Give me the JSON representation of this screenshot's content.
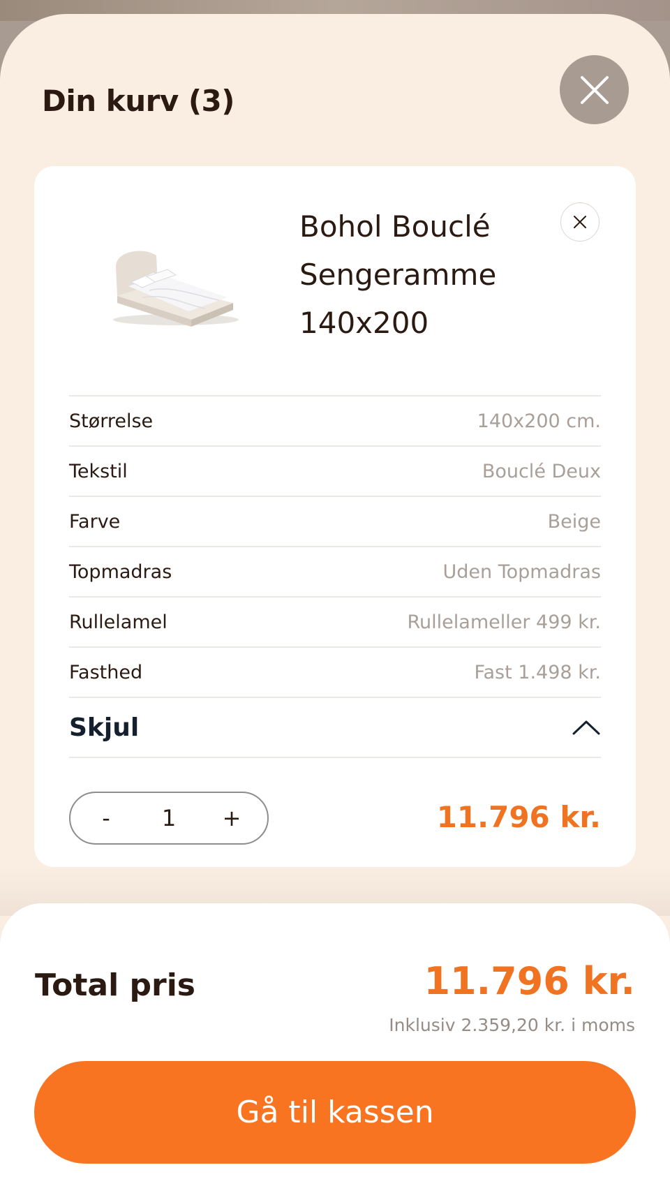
{
  "header": {
    "title": "Din kurv (3)",
    "close_icon": "close-icon"
  },
  "item": {
    "name_line1": "Bohol Bouclé",
    "name_line2": "Sengeramme",
    "name_line3": "140x200",
    "image": "bed-frame-image",
    "remove_icon": "close-icon",
    "specs": [
      {
        "label": "Størrelse",
        "value": "140x200 cm."
      },
      {
        "label": "Tekstil",
        "value": "Bouclé Deux"
      },
      {
        "label": "Farve",
        "value": "Beige"
      },
      {
        "label": "Topmadras",
        "value": "Uden Topmadras"
      },
      {
        "label": "Rullelamel",
        "value": "Rullelameller 499 kr."
      },
      {
        "label": "Fasthed",
        "value": "Fast 1.498 kr."
      }
    ],
    "toggle_label": "Skjul",
    "toggle_icon": "chevron-up-icon",
    "quantity": {
      "decrement": "-",
      "value": "1",
      "increment": "+"
    },
    "price": "11.796 kr."
  },
  "summary": {
    "total_label": "Total pris",
    "total_price": "11.796 kr.",
    "vat_note": "Inklusiv 2.359,20 kr. i moms",
    "checkout_label": "Gå til kassen"
  },
  "colors": {
    "accent": "#f97420",
    "price": "#f07322",
    "sheet_background": "#faeee3",
    "close_button": "#a89c92"
  }
}
